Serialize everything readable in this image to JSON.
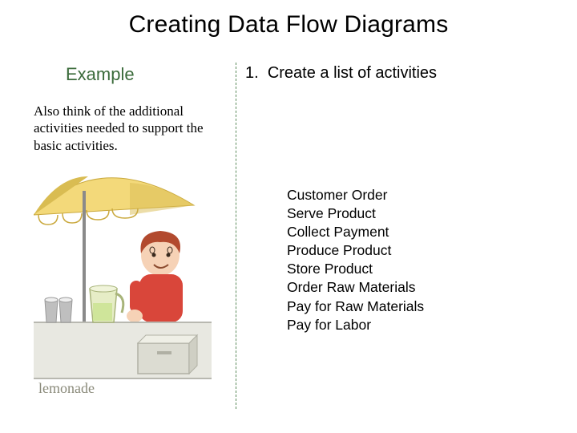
{
  "title": "Creating Data Flow Diagrams",
  "example_label": "Example",
  "step": {
    "num": "1.",
    "text": "Create a list of activities"
  },
  "description": "Also think of the additional activities needed to support the basic activities.",
  "activities": [
    "Customer Order",
    "Serve Product",
    "Collect Payment",
    "Produce Product",
    "Store Product",
    "Order Raw Materials",
    "Pay for Raw Materials",
    "Pay for Labor"
  ],
  "illustration": {
    "alt": "lemonade-stand-clipart",
    "label_text": "lemonade",
    "colors": {
      "umbrella": "#f3d97a",
      "umbrella_dark": "#d9bc52",
      "pole": "#8a8a8a",
      "counter": "#e8e8e1",
      "counter_line": "#b8b8b0",
      "hair": "#b24a2e",
      "skin": "#f6d2b6",
      "shirt": "#d9463a",
      "glass": "#cfe59a",
      "pitcher": "#e6edc6",
      "cups": "#bfbfbf",
      "box": "#dcdcd2"
    }
  }
}
